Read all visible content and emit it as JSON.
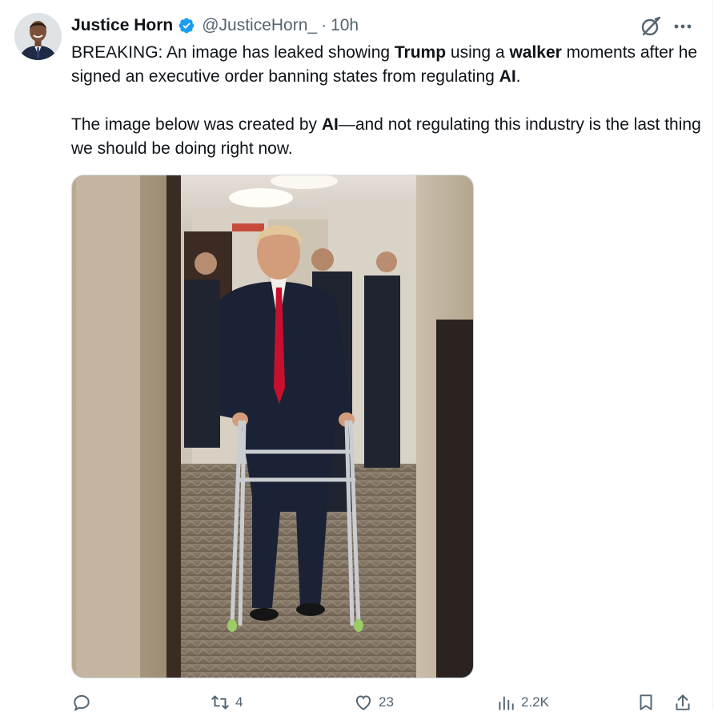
{
  "author": {
    "display_name": "Justice Horn",
    "handle": "@JusticeHorn_",
    "separator": "·",
    "time": "10h",
    "verified": true
  },
  "tweet": {
    "paragraph1": [
      {
        "text": "BREAKING: An image has leaked showing ",
        "bold": false
      },
      {
        "text": "Trump",
        "bold": true
      },
      {
        "text": " using a ",
        "bold": false
      },
      {
        "text": "walker",
        "bold": true
      },
      {
        "text": " moments after he signed an executive order banning states from regulating ",
        "bold": false
      },
      {
        "text": "AI",
        "bold": true
      },
      {
        "text": ".",
        "bold": false
      }
    ],
    "paragraph2": [
      {
        "text": "The image below was created by ",
        "bold": false
      },
      {
        "text": "AI",
        "bold": true
      },
      {
        "text": "—and not regulating this industry is the last thing we should be doing right now.",
        "bold": false
      }
    ]
  },
  "actions": {
    "reply_count": "",
    "retweet_count": "4",
    "like_count": "23",
    "views_count": "2.2K"
  },
  "icons": {
    "verified": "verified-badge-icon",
    "grok": "grok-icon",
    "more": "more-options-icon",
    "reply": "reply-icon",
    "retweet": "retweet-icon",
    "like": "heart-icon",
    "views": "views-icon",
    "bookmark": "bookmark-icon",
    "share": "share-icon"
  },
  "colors": {
    "verified_blue": "#1d9bf0",
    "text_primary": "#0f1419",
    "text_secondary": "#536471",
    "tie_red": "#c8102e"
  }
}
